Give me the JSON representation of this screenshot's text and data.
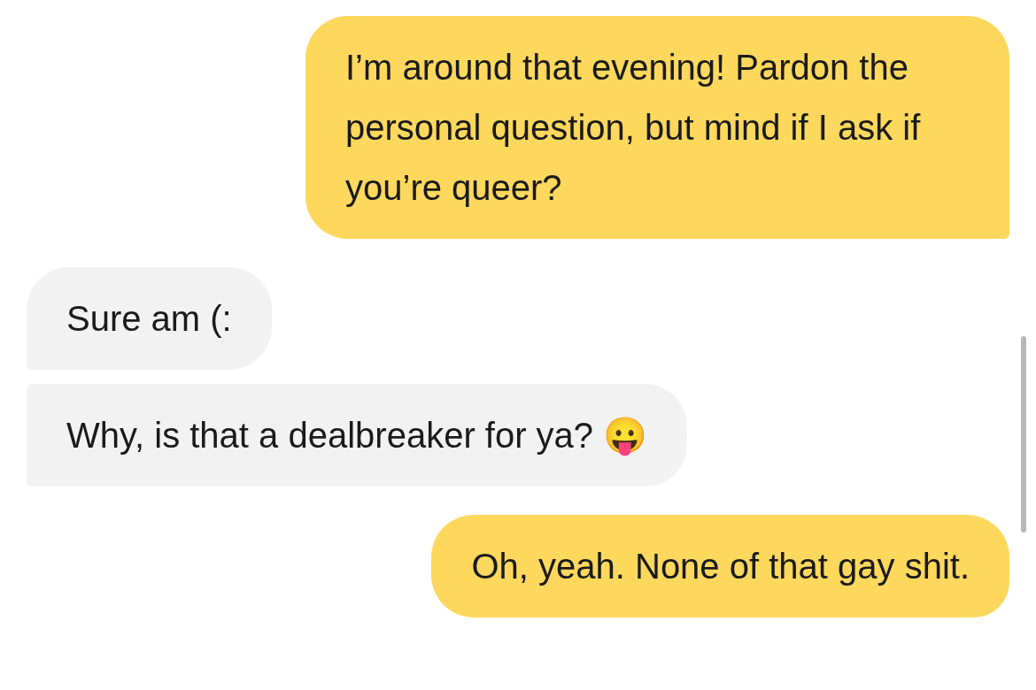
{
  "messages": [
    {
      "kind": "sent",
      "text": "I’m around that evening! Pardon the personal question, but mind if I ask if you’re queer?"
    },
    {
      "kind": "received",
      "text": "Sure am (:"
    },
    {
      "kind": "received",
      "text": "Why, is that a dealbreaker for ya? 😛"
    },
    {
      "kind": "sent",
      "text": "Oh, yeah. None of that gay shit."
    }
  ]
}
